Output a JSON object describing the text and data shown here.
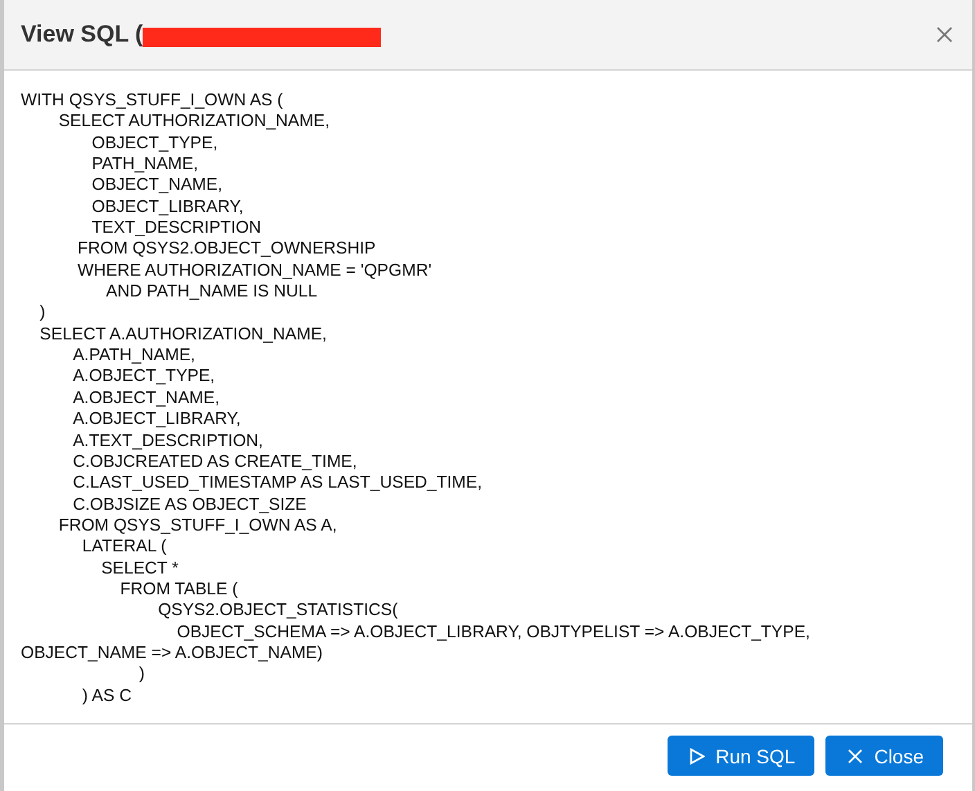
{
  "dialog": {
    "title": "View SQL (",
    "sql": "WITH QSYS_STUFF_I_OWN AS (\n        SELECT AUTHORIZATION_NAME,\n               OBJECT_TYPE,\n               PATH_NAME,\n               OBJECT_NAME,\n               OBJECT_LIBRARY,\n               TEXT_DESCRIPTION\n            FROM QSYS2.OBJECT_OWNERSHIP\n            WHERE AUTHORIZATION_NAME = 'QPGMR'\n                  AND PATH_NAME IS NULL\n    )\n    SELECT A.AUTHORIZATION_NAME,\n           A.PATH_NAME,\n           A.OBJECT_TYPE,\n           A.OBJECT_NAME,\n           A.OBJECT_LIBRARY,\n           A.TEXT_DESCRIPTION,\n           C.OBJCREATED AS CREATE_TIME,\n           C.LAST_USED_TIMESTAMP AS LAST_USED_TIME,\n           C.OBJSIZE AS OBJECT_SIZE\n        FROM QSYS_STUFF_I_OWN AS A,\n             LATERAL (\n                 SELECT *\n                     FROM TABLE (\n                             QSYS2.OBJECT_STATISTICS(\n                                 OBJECT_SCHEMA => A.OBJECT_LIBRARY, OBJTYPELIST => A.OBJECT_TYPE,\nOBJECT_NAME => A.OBJECT_NAME)\n                         )\n             ) AS C",
    "buttons": [
      {
        "kind": "run",
        "label": "Run SQL"
      },
      {
        "kind": "close",
        "label": "Close"
      }
    ]
  }
}
